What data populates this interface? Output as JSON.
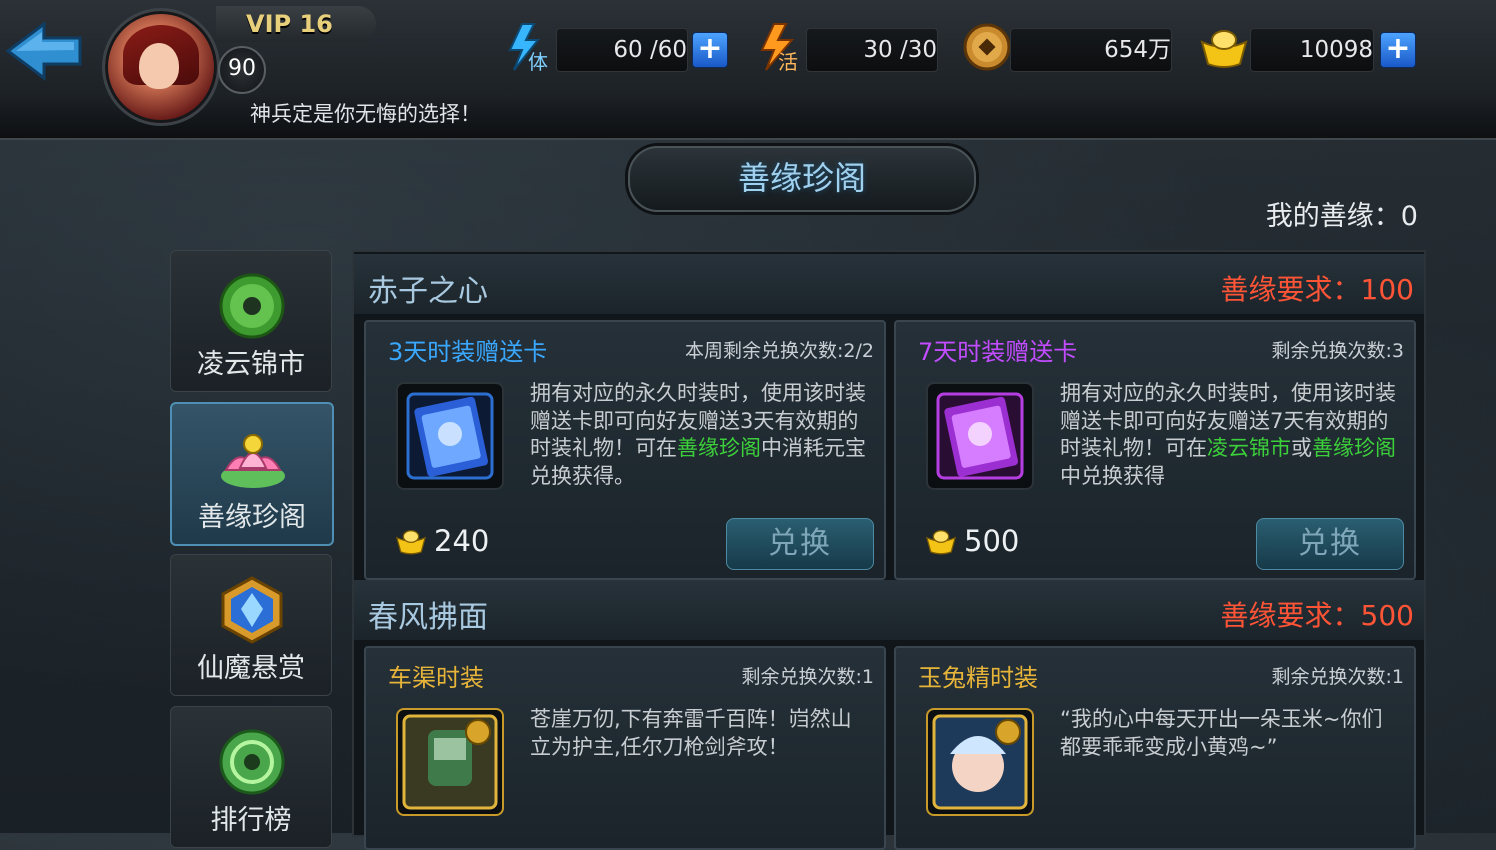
{
  "player": {
    "vip": "VIP 16",
    "level": "90",
    "marquee": "神兵定是你无悔的选择！"
  },
  "resources": {
    "stamina": {
      "icon": "stamina-lightning-icon",
      "tag": "体",
      "value": "60 /60"
    },
    "vitality": {
      "icon": "vitality-flame-icon",
      "tag": "活",
      "value": "30 /30"
    },
    "coins": {
      "icon": "copper-coin-icon",
      "value": "654万"
    },
    "ingots": {
      "icon": "gold-ingot-icon",
      "value": "10098"
    }
  },
  "header": {
    "title": "善缘珍阁",
    "my_points": "我的善缘：0"
  },
  "sidebar": {
    "items": [
      {
        "label": "凌云锦市",
        "icon": "jade-coin-icon",
        "active": false
      },
      {
        "label": "善缘珍阁",
        "icon": "lotus-icon",
        "active": true
      },
      {
        "label": "仙魔悬赏",
        "icon": "crystal-badge-icon",
        "active": false
      },
      {
        "label": "排行榜",
        "icon": "jade-medal-icon",
        "active": false
      }
    ]
  },
  "sections": [
    {
      "name": "赤子之心",
      "requirement": "善缘要求：100",
      "cards": [
        {
          "title": "3天时装赠送卡",
          "title_color": "#3aa8ff",
          "limit": "本周剩余兑换次数:2/2",
          "desc_parts": [
            {
              "t": "拥有对应的永久时装时，使用该时装赠送卡即可向好友赠送3天有效期的时装礼物！可在",
              "g": false
            },
            {
              "t": "善缘珍阁",
              "g": true
            },
            {
              "t": "中消耗元宝兑换获得。",
              "g": false
            }
          ],
          "price": "240",
          "button": "兑换",
          "item_icon": "blue-gift-card-icon"
        },
        {
          "title": "7天时装赠送卡",
          "title_color": "#c24cff",
          "limit": "剩余兑换次数:3",
          "desc_parts": [
            {
              "t": "拥有对应的永久时装时，使用该时装赠送卡即可向好友赠送7天有效期的时装礼物！可在",
              "g": false
            },
            {
              "t": "凌云锦市",
              "g": true
            },
            {
              "t": "或",
              "g": false
            },
            {
              "t": "善缘珍阁",
              "g": true
            },
            {
              "t": "中兑换获得",
              "g": false
            }
          ],
          "price": "500",
          "button": "兑换",
          "item_icon": "purple-gift-card-icon"
        }
      ]
    },
    {
      "name": "春风拂面",
      "requirement": "善缘要求：500",
      "cards": [
        {
          "title": "车渠时装",
          "title_color": "#e7b43a",
          "limit": "剩余兑换次数:1",
          "desc_parts": [
            {
              "t": "苍崖万仞,下有奔雷千百阵！岿然山立为护主,任尔刀枪剑斧攻！",
              "g": false
            }
          ],
          "item_icon": "armored-warrior-costume-icon"
        },
        {
          "title": "玉兔精时装",
          "title_color": "#e7b43a",
          "limit": "剩余兑换次数:1",
          "desc_parts": [
            {
              "t": "“我的心中每天开出一朵玉米~你们都要乖乖变成小黄鸡~”",
              "g": false
            }
          ],
          "item_icon": "jade-rabbit-costume-icon"
        }
      ]
    }
  ],
  "colors": {
    "requirement_red": "#ff5436",
    "highlight_green": "#3cd03a",
    "accent_blue": "#3aa8ff"
  }
}
